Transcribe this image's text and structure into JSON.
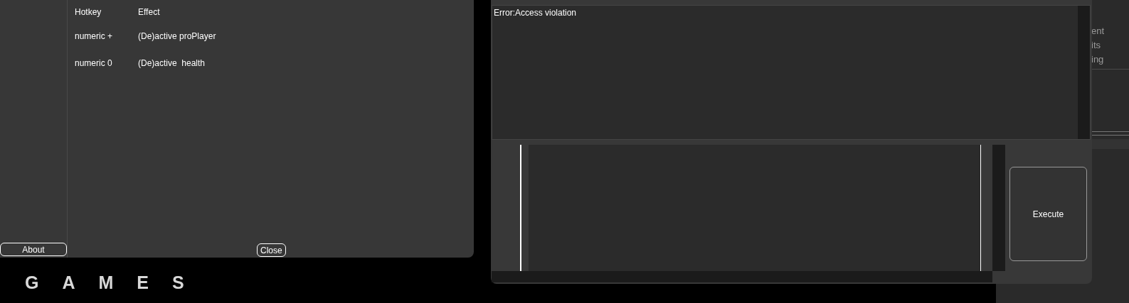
{
  "hotkeys_window": {
    "columns": [
      "Hotkey",
      "Effect"
    ],
    "rows": [
      {
        "hotkey": "numeric +",
        "effect": "(De)active proPlayer"
      },
      {
        "hotkey": "numeric 0",
        "effect": "(De)active  health"
      }
    ],
    "about_button": "About",
    "close_button": "Close"
  },
  "logo": {
    "text": "GAMES"
  },
  "console_window": {
    "output": "Error:Access violation",
    "execute_button": "Execute"
  },
  "background_window": {
    "items": [
      "ent",
      "its",
      "ing"
    ]
  }
}
